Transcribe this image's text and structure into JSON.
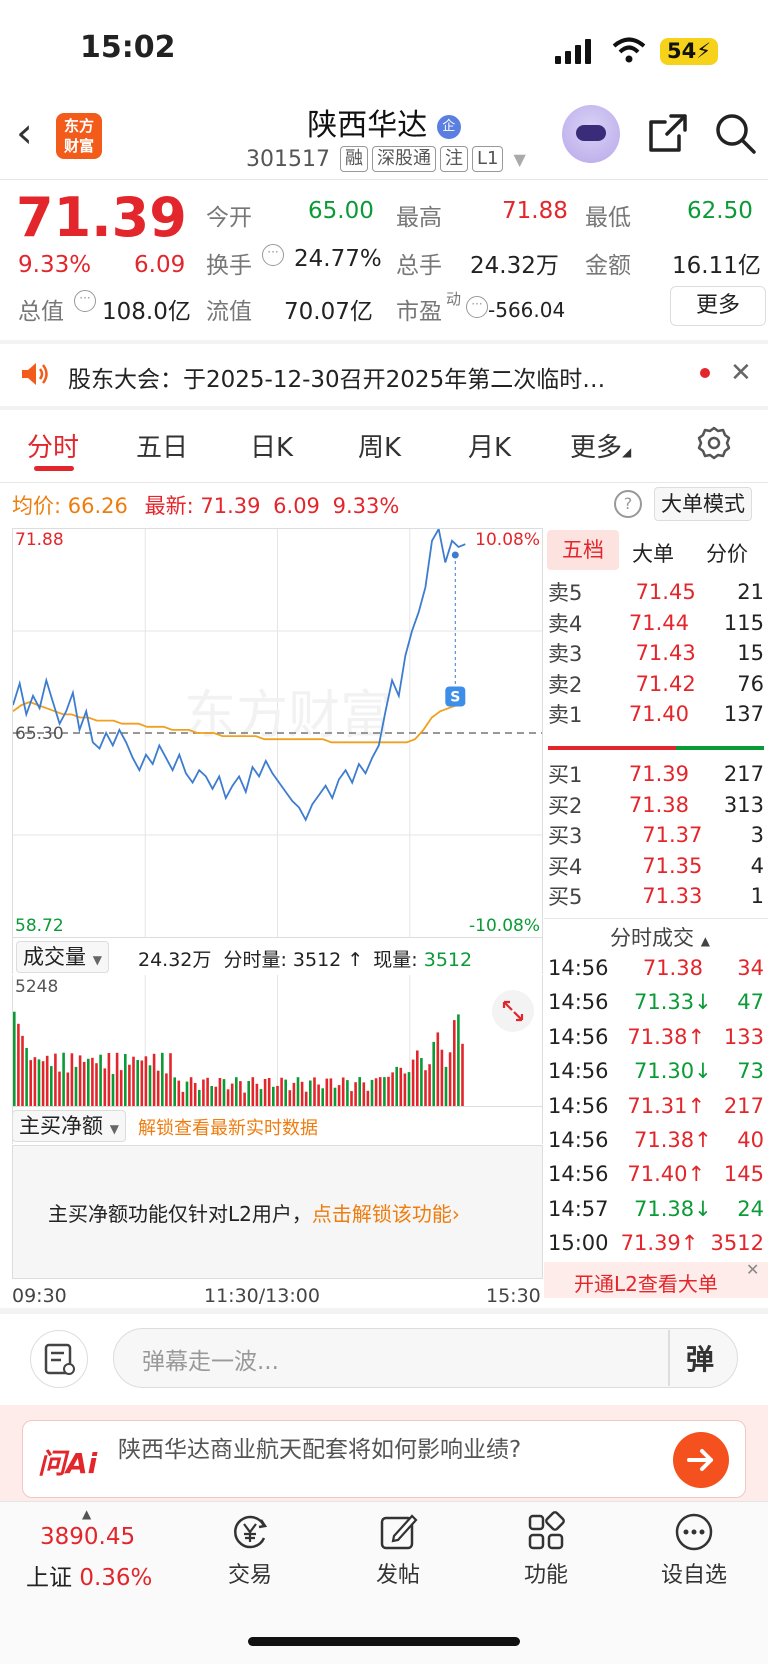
{
  "status_bar": {
    "time": "15:02",
    "battery": "54"
  },
  "header": {
    "logo": "东方财富",
    "stock_name": "陕西华达",
    "name_badge": "企",
    "code": "301517",
    "tags": [
      "融",
      "深股通",
      "注",
      "L1"
    ]
  },
  "quote": {
    "price": "71.39",
    "change_pct": "9.33%",
    "change": "6.09",
    "open_label": "今开",
    "open": "65.00",
    "high_label": "最高",
    "high": "71.88",
    "low_label": "最低",
    "low": "62.50",
    "turnover_label": "换手",
    "turnover": "24.77%",
    "volume_label": "总手",
    "volume": "24.32万",
    "amount_label": "金额",
    "amount": "16.11亿",
    "mktcap_label": "总值",
    "mktcap": "108.0亿",
    "float_label": "流值",
    "float": "70.07亿",
    "pe_label": "市盈",
    "pe_sup": "动",
    "pe": "-566.04",
    "more_label": "更多"
  },
  "notice": {
    "text": "股东大会：于2025-12-30召开2025年第二次临时…"
  },
  "tabs": [
    "分时",
    "五日",
    "日K",
    "周K",
    "月K",
    "更多"
  ],
  "chart_header": {
    "avg_label": "均价:",
    "avg": "66.26",
    "latest_label": "最新:",
    "latest": "71.39",
    "latest_change": "6.09",
    "latest_pct": "9.33%",
    "mode_btn": "大单模式"
  },
  "chart_data": {
    "type": "line",
    "y_max_label": "71.88",
    "y_mid_label": "65.30",
    "y_min_label": "58.72",
    "pct_max_label": "10.08%",
    "pct_min_label": "-10.08%",
    "watermark": "东方财富",
    "ylim": [
      58.72,
      71.88
    ],
    "prev_close": 65.3,
    "x_labels": [
      "09:30",
      "11:30/13:00",
      "15:30"
    ],
    "series": [
      {
        "values": [
          66.2,
          66.9,
          65.9,
          66.5,
          66.1,
          67.0,
          66.3,
          65.6,
          66.0,
          66.6,
          65.4,
          66.0,
          65.0,
          64.8,
          65.3,
          64.9,
          65.4,
          65.0,
          64.5,
          64.1,
          64.6,
          64.3,
          64.9,
          64.5,
          64.1,
          64.6,
          64.0,
          63.7,
          64.1,
          63.9,
          63.5,
          63.9,
          63.2,
          63.6,
          63.9,
          63.4,
          64.2,
          63.9,
          64.4,
          64.0,
          63.7,
          63.4,
          63.1,
          62.9,
          62.5,
          63.0,
          63.3,
          63.6,
          63.2,
          63.8,
          64.1,
          63.7,
          64.3,
          64.0,
          64.5,
          64.9,
          66.0,
          67.0,
          66.5,
          67.8,
          68.6,
          69.2,
          70.0,
          71.5,
          71.88,
          70.8,
          71.5,
          71.3,
          71.39
        ]
      },
      {
        "values": [
          66.0,
          66.2,
          66.3,
          66.2,
          66.1,
          66.0,
          65.9,
          65.9,
          65.8,
          65.8,
          65.7,
          65.7,
          65.7,
          65.6,
          65.6,
          65.6,
          65.5,
          65.5,
          65.5,
          65.4,
          65.4,
          65.4,
          65.3,
          65.3,
          65.3,
          65.2,
          65.2,
          65.2,
          65.2,
          65.2,
          65.1,
          65.1,
          65.1,
          65.1,
          65.1,
          65.1,
          65.1,
          65.1,
          65.0,
          65.0,
          65.0,
          65.0,
          65.0,
          65.0,
          65.0,
          65.0,
          65.0,
          65.0,
          65.1,
          65.4,
          65.8,
          66.0,
          66.1,
          66.2,
          66.26
        ]
      }
    ]
  },
  "volume": {
    "indicator": "成交量",
    "total": "24.32万",
    "period_label": "分时量:",
    "period_value": "3512",
    "current_label": "现量:",
    "current_value": "3512",
    "max_label": "5248"
  },
  "main_net": {
    "indicator": "主买净额",
    "unlock_hint": "解锁查看最新实时数据",
    "info": "主买净额功能仅针对L2用户，",
    "unlock_link": "点击解锁该功能"
  },
  "order_book": {
    "tabs": [
      "五档",
      "大单",
      "分价"
    ],
    "asks": [
      {
        "label": "卖5",
        "price": "71.45",
        "vol": "21"
      },
      {
        "label": "卖4",
        "price": "71.44",
        "vol": "115"
      },
      {
        "label": "卖3",
        "price": "71.43",
        "vol": "15"
      },
      {
        "label": "卖2",
        "price": "71.42",
        "vol": "76"
      },
      {
        "label": "卖1",
        "price": "71.40",
        "vol": "137"
      }
    ],
    "bids": [
      {
        "label": "买1",
        "price": "71.39",
        "vol": "217"
      },
      {
        "label": "买2",
        "price": "71.38",
        "vol": "313"
      },
      {
        "label": "买3",
        "price": "71.37",
        "vol": "3"
      },
      {
        "label": "买4",
        "price": "71.35",
        "vol": "4"
      },
      {
        "label": "买5",
        "price": "71.33",
        "vol": "1"
      }
    ]
  },
  "trades": {
    "title": "分时成交",
    "rows": [
      {
        "time": "14:56",
        "price": "71.38",
        "dir": "",
        "vol": "34"
      },
      {
        "time": "14:56",
        "price": "71.33",
        "dir": "↓",
        "vol": "47"
      },
      {
        "time": "14:56",
        "price": "71.38",
        "dir": "↑",
        "vol": "133"
      },
      {
        "time": "14:56",
        "price": "71.30",
        "dir": "↓",
        "vol": "73"
      },
      {
        "time": "14:56",
        "price": "71.31",
        "dir": "↑",
        "vol": "217"
      },
      {
        "time": "14:56",
        "price": "71.38",
        "dir": "↑",
        "vol": "40"
      },
      {
        "time": "14:56",
        "price": "71.40",
        "dir": "↑",
        "vol": "145"
      },
      {
        "time": "14:57",
        "price": "71.38",
        "dir": "↓",
        "vol": "24"
      },
      {
        "time": "15:00",
        "price": "71.39",
        "dir": "↑",
        "vol": "3512"
      }
    ],
    "l2_banner": "开通L2查看大单"
  },
  "comment": {
    "placeholder": "弹幕走一波...",
    "danmu_label": "弹"
  },
  "ai": {
    "logo": "问Ai",
    "question": "陕西华达商业航天配套将如何影响业绩?"
  },
  "bottom_nav": {
    "index_value": "3890.45",
    "index_name": "上证",
    "index_pct": "0.36%",
    "items": [
      "交易",
      "发帖",
      "功能",
      "设自选"
    ]
  },
  "colors": {
    "up": "#e3262b",
    "down": "#0a9b37",
    "price_line": "#3d7ccf",
    "avg_line": "#f0a020"
  }
}
